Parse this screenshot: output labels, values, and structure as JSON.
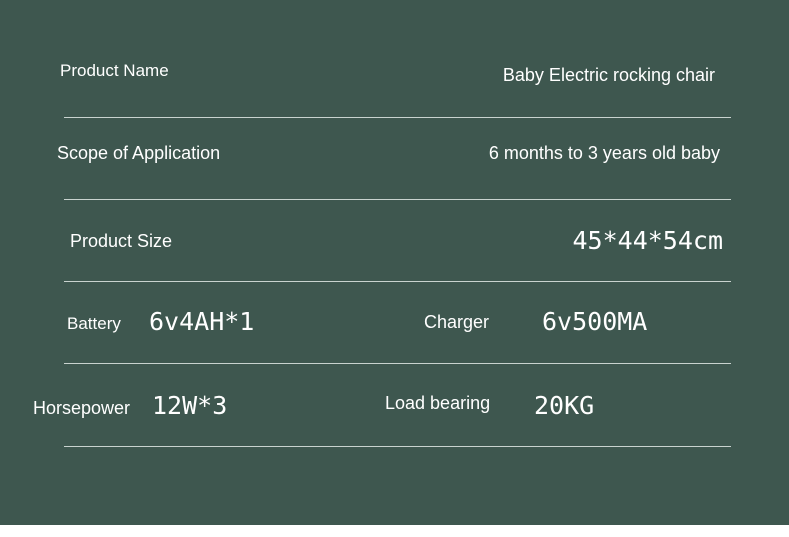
{
  "specs": {
    "product_name": {
      "label": "Product Name",
      "value": "Baby Electric rocking chair"
    },
    "scope": {
      "label": "Scope of Application",
      "value": "6 months to 3 years old baby"
    },
    "size": {
      "label": "Product Size",
      "value": "45*44*54cm"
    },
    "battery": {
      "label": "Battery",
      "value": "6v4AH*1"
    },
    "charger": {
      "label": "Charger",
      "value": "6v500MA"
    },
    "horsepower": {
      "label": "Horsepower",
      "value": "12W*3"
    },
    "load": {
      "label": "Load bearing",
      "value": "20KG"
    }
  },
  "colors": {
    "background": "#3e574f",
    "text": "#ffffff",
    "divider": "#c9d3cf"
  }
}
